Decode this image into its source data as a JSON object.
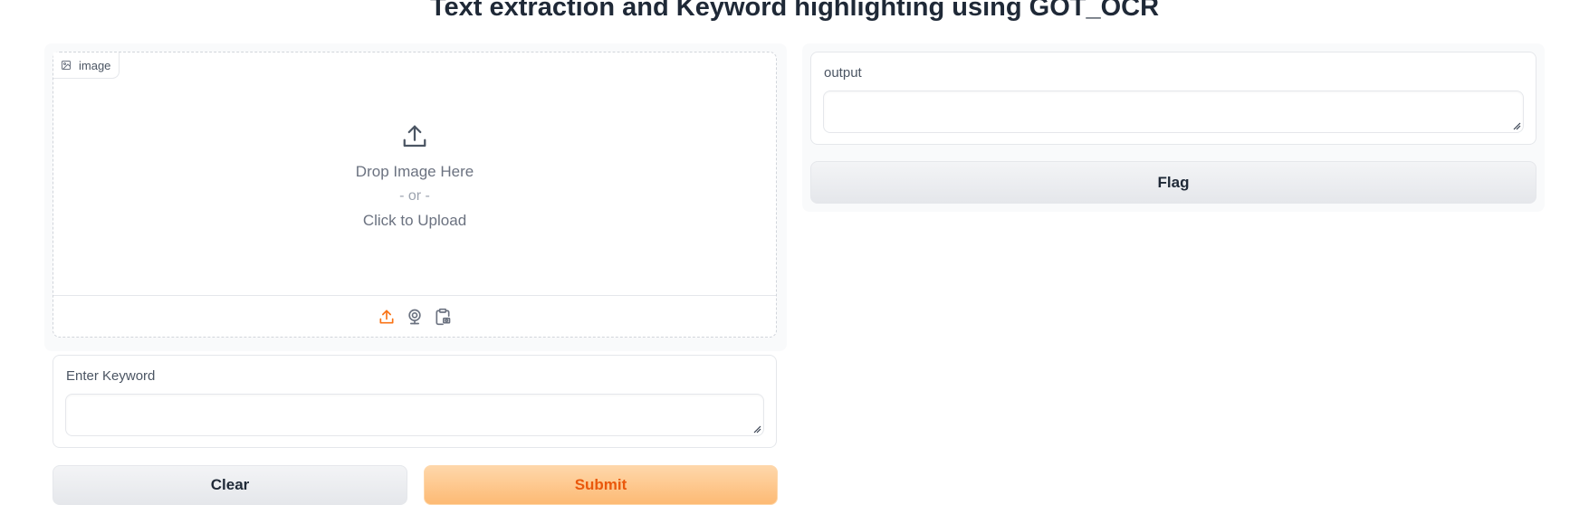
{
  "title": "Text extraction and Keyword highlighting using GOT_OCR",
  "image_input": {
    "label": "image",
    "drop_text": "Drop Image Here",
    "or_text": "- or -",
    "click_text": "Click to Upload",
    "toolbar_icons": [
      "upload-icon",
      "webcam-icon",
      "clipboard-icon"
    ],
    "active_icon_color": "#f97316"
  },
  "keyword_input": {
    "label": "Enter Keyword",
    "value": ""
  },
  "output": {
    "label": "output",
    "value": ""
  },
  "buttons": {
    "clear": "Clear",
    "submit": "Submit",
    "flag": "Flag"
  },
  "colors": {
    "primary_text": "#ea580c",
    "primary_bg": "#fdba74"
  }
}
